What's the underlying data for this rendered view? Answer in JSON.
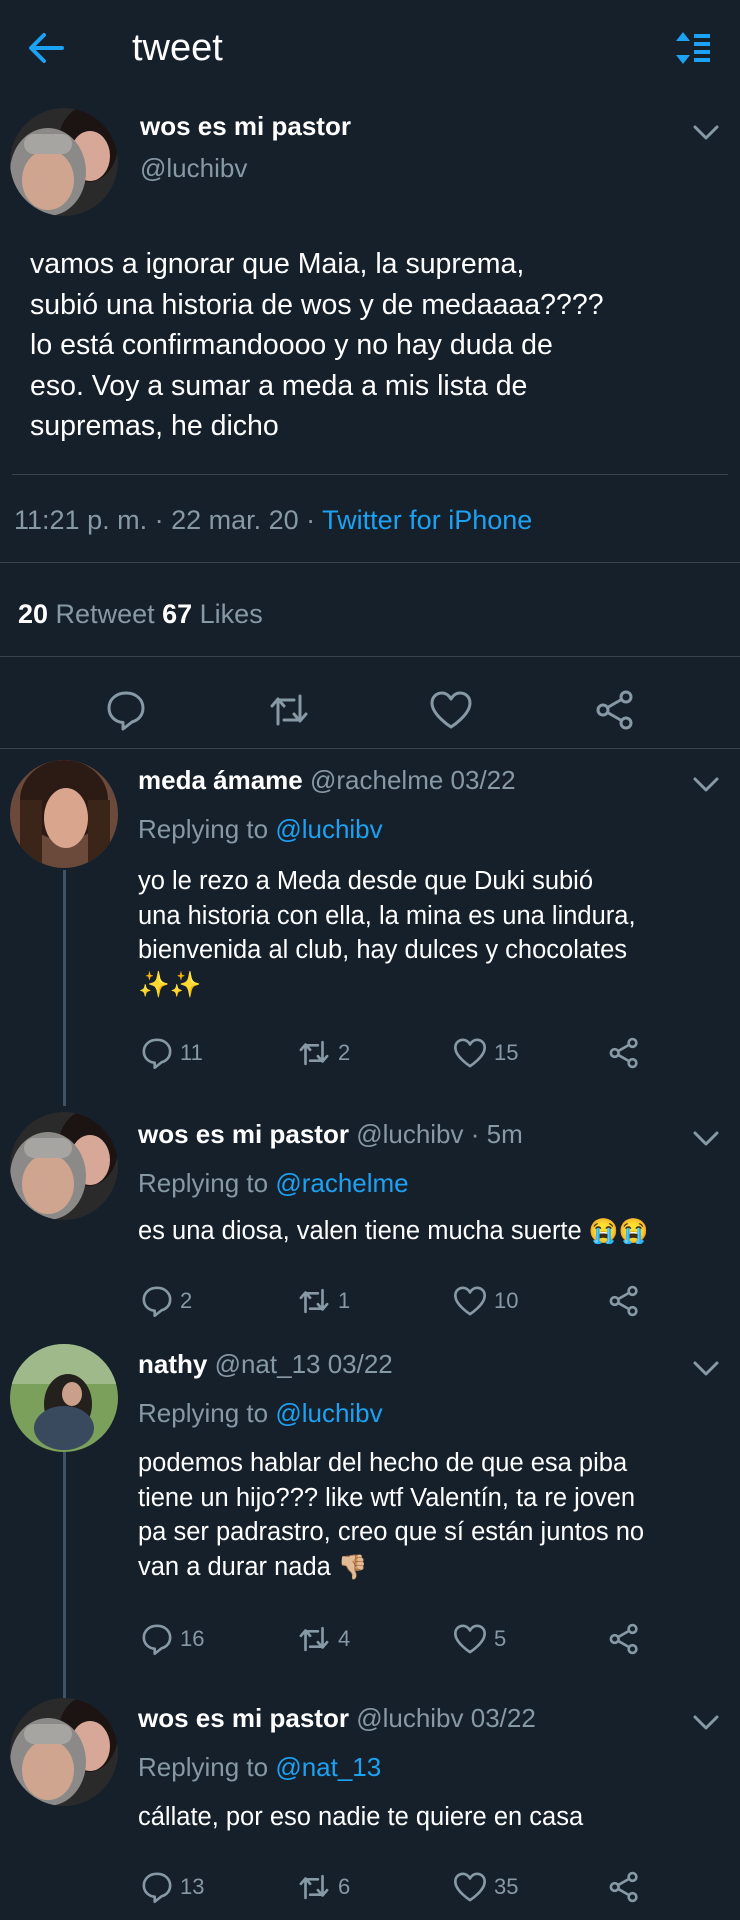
{
  "header": {
    "title": "tweet"
  },
  "main_tweet": {
    "name": "wos es mi pastor",
    "handle": "@luchibv",
    "text_lines": [
      "vamos a ignorar que Maia, la suprema,",
      "subió una historia de wos y de medaaaa????",
      "lo está confirmandoooo y no hay duda de",
      "eso. Voy a sumar a meda a mis lista de",
      "supremas, he dicho"
    ],
    "time": "11:21 p. m.",
    "sep1": " · ",
    "date": "22 mar. 20",
    "sep2": " · ",
    "source": "Twitter for iPhone",
    "retweets": "20",
    "retweets_label": " Retweet ",
    "likes": "67",
    "likes_label": " Likes"
  },
  "replies": [
    {
      "name": "meda ámame",
      "meta": " @rachelme 03/22",
      "replying_prefix": "Replying to ",
      "replying_to": "@luchibv",
      "text_lines": [
        "yo le rezo a Meda desde que Duki subió",
        "una historia con ella, la mina es una lindura,",
        "bienvenida al club, hay dulces y chocolates"
      ],
      "emoji_line": "✨✨",
      "replies": "11",
      "retweets": "2",
      "likes": "15"
    },
    {
      "name": "wos es mi pastor",
      "meta": " @luchibv · 5m",
      "replying_prefix": "Replying to ",
      "replying_to": "@rachelme",
      "text_lines": [
        "es una diosa, valen tiene mucha suerte "
      ],
      "emoji_inline": "😭😭",
      "replies": "2",
      "retweets": "1",
      "likes": "10"
    },
    {
      "name": "nathy",
      "meta": " @nat_13 03/22",
      "replying_prefix": "Replying to ",
      "replying_to": "@luchibv",
      "text_lines": [
        "podemos hablar del hecho de que esa piba",
        "tiene un hijo??? like wtf Valentín, ta re joven",
        "pa ser padrastro, creo que sí están juntos no",
        "van a durar nada "
      ],
      "emoji_inline": "👎🏼",
      "replies": "16",
      "retweets": "4",
      "likes": "5"
    },
    {
      "name": "wos es mi pastor",
      "meta": " @luchibv 03/22",
      "replying_prefix": "Replying to ",
      "replying_to": "@nat_13",
      "text_lines": [
        "cállate, por eso nadie te quiere en casa"
      ],
      "replies": "13",
      "retweets": "6",
      "likes": "35"
    }
  ],
  "icons": {
    "back": "arrow-left-icon",
    "sort": "sort-icon",
    "reply": "reply-icon",
    "retweet": "retweet-icon",
    "like": "heart-icon",
    "share": "share-icon",
    "chevron": "chevron-down-icon"
  },
  "colors": {
    "background": "#15202b",
    "accent": "#1da1f2",
    "muted": "#8899a6",
    "divider": "#38444d"
  }
}
